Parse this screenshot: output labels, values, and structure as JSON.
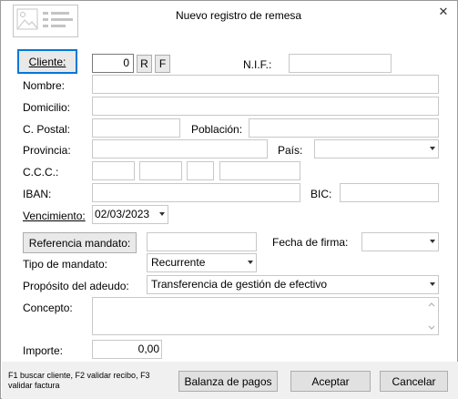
{
  "window": {
    "title": "Nuevo registro de remesa",
    "close_glyph": "✕"
  },
  "cliente": {
    "button_label": "Cliente:",
    "code_value": "0",
    "r_label": "R",
    "f_label": "F"
  },
  "nif": {
    "label": "N.I.F.:",
    "value": ""
  },
  "nombre": {
    "label": "Nombre:",
    "value": ""
  },
  "domicilio": {
    "label": "Domicilio:",
    "value": ""
  },
  "cpostal": {
    "label": "C. Postal:",
    "value": ""
  },
  "poblacion": {
    "label": "Población:",
    "value": ""
  },
  "provincia": {
    "label": "Provincia:",
    "value": ""
  },
  "pais": {
    "label": "País:",
    "value": ""
  },
  "ccc": {
    "label": "C.C.C.:",
    "values": [
      "",
      "",
      "",
      ""
    ]
  },
  "iban": {
    "label": "IBAN:",
    "value": ""
  },
  "bic": {
    "label": "BIC:",
    "value": ""
  },
  "vencimiento": {
    "label": "Vencimiento:",
    "value": "02/03/2023"
  },
  "mandato": {
    "ref_button": "Referencia mandato:",
    "ref_value": "",
    "fecha_firma_label": "Fecha de firma:",
    "fecha_firma_value": ""
  },
  "tipo_mandato": {
    "label": "Tipo de mandato:",
    "value": "Recurrente"
  },
  "proposito": {
    "label": "Propósito del adeudo:",
    "value": "Transferencia de gestión de efectivo"
  },
  "concepto": {
    "label": "Concepto:",
    "value": ""
  },
  "importe": {
    "label": "Importe:",
    "value": "0,00"
  },
  "footer": {
    "hint": "F1 buscar cliente, F2 validar recibo, F3 validar factura",
    "balanza_button": "Balanza de pagos",
    "aceptar_button": "Aceptar",
    "cancelar_button": "Cancelar"
  },
  "colors": {
    "focus_border": "#0078d7",
    "button_bg": "#e9e9e9",
    "field_border": "#c8c8c8",
    "footer_bg": "#f0f0f0"
  }
}
